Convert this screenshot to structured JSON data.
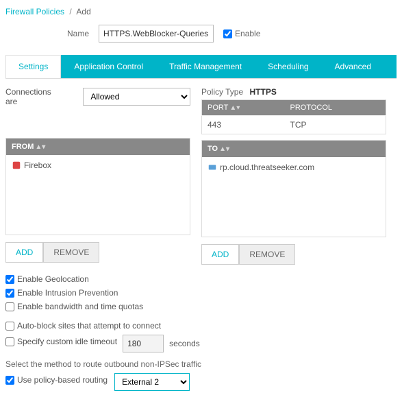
{
  "breadcrumb": {
    "parent": "Firewall Policies",
    "sep": "/",
    "current": "Add"
  },
  "name": {
    "label": "Name",
    "value": "HTTPS.WebBlocker-Queries"
  },
  "enable": {
    "label": "Enable",
    "checked": true
  },
  "tabs": [
    {
      "label": "Settings",
      "active": true
    },
    {
      "label": "Application Control",
      "active": false
    },
    {
      "label": "Traffic Management",
      "active": false
    },
    {
      "label": "Scheduling",
      "active": false
    },
    {
      "label": "Advanced",
      "active": false
    }
  ],
  "connections": {
    "label": "Connections are",
    "value": "Allowed"
  },
  "policy_type": {
    "label": "Policy Type",
    "value": "HTTPS"
  },
  "port_table": {
    "headers": [
      "PORT",
      "PROTOCOL"
    ],
    "rows": [
      {
        "port": "443",
        "protocol": "TCP"
      }
    ]
  },
  "from": {
    "header": "FROM",
    "items": [
      "Firebox"
    ]
  },
  "to": {
    "header": "TO",
    "items": [
      "rp.cloud.threatseeker.com"
    ]
  },
  "buttons": {
    "add": "ADD",
    "remove": "REMOVE"
  },
  "checks": {
    "geo": {
      "label": "Enable Geolocation",
      "checked": true
    },
    "ips": {
      "label": "Enable Intrusion Prevention",
      "checked": true
    },
    "bw": {
      "label": "Enable bandwidth and time quotas",
      "checked": false
    },
    "autoblock": {
      "label": "Auto-block sites that attempt to connect",
      "checked": false
    }
  },
  "idle": {
    "label": "Specify custom idle timeout",
    "value": "180",
    "unit": "seconds",
    "checked": false
  },
  "route": {
    "desc": "Select the method to route outbound non-IPSec traffic",
    "pbr": {
      "label": "Use policy-based routing",
      "checked": true,
      "value": "External 2"
    }
  }
}
